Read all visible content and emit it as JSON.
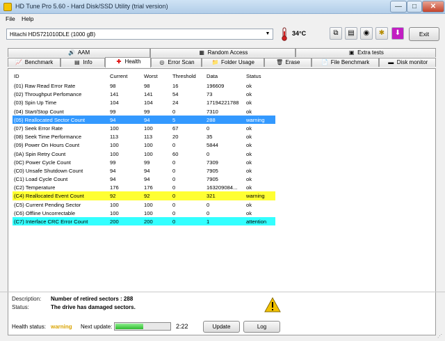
{
  "window": {
    "title": "HD Tune Pro 5.60 - Hard Disk/SSD Utility (trial version)",
    "min_label": "—",
    "max_label": "□",
    "close_label": "✕"
  },
  "menu": [
    "File",
    "Help"
  ],
  "toolbar": {
    "drive": "Hitachi HDS721010DLE (1000 gB)",
    "temperature": "34°C",
    "exit_label": "Exit"
  },
  "tabs_top": [
    {
      "label": "AAM",
      "icon": "speaker-icon"
    },
    {
      "label": "Random Access",
      "icon": "random-access-icon"
    },
    {
      "label": "Extra tests",
      "icon": "extra-tests-icon"
    }
  ],
  "tabs_bottom": [
    {
      "label": "Benchmark",
      "icon": "benchmark-icon"
    },
    {
      "label": "Info",
      "icon": "info-icon"
    },
    {
      "label": "Health",
      "icon": "health-cross-icon",
      "active": true
    },
    {
      "label": "Error Scan",
      "icon": "error-scan-icon"
    },
    {
      "label": "Folder Usage",
      "icon": "folder-usage-icon"
    },
    {
      "label": "Erase",
      "icon": "trash-icon"
    },
    {
      "label": "File Benchmark",
      "icon": "file-benchmark-icon"
    },
    {
      "label": "Disk monitor",
      "icon": "disk-monitor-icon"
    }
  ],
  "table": {
    "headers": [
      "ID",
      "Current",
      "Worst",
      "Threshold",
      "Data",
      "Status"
    ],
    "rows": [
      {
        "id": "(01) Raw Read Error Rate",
        "current": "98",
        "worst": "98",
        "threshold": "16",
        "data": "196609",
        "status": "ok",
        "hl": ""
      },
      {
        "id": "(02) Throughput Perfomance",
        "current": "141",
        "worst": "141",
        "threshold": "54",
        "data": "73",
        "status": "ok",
        "hl": ""
      },
      {
        "id": "(03) Spin Up Time",
        "current": "104",
        "worst": "104",
        "threshold": "24",
        "data": "17194221788",
        "status": "ok",
        "hl": ""
      },
      {
        "id": "(04) Start/Stop Count",
        "current": "99",
        "worst": "99",
        "threshold": "0",
        "data": "7310",
        "status": "ok",
        "hl": ""
      },
      {
        "id": "(05) Reallocated Sector Count",
        "current": "94",
        "worst": "94",
        "threshold": "5",
        "data": "288",
        "status": "warning",
        "hl": "blue"
      },
      {
        "id": "(07) Seek Error Rate",
        "current": "100",
        "worst": "100",
        "threshold": "67",
        "data": "0",
        "status": "ok",
        "hl": ""
      },
      {
        "id": "(08) Seek Time Performance",
        "current": "113",
        "worst": "113",
        "threshold": "20",
        "data": "35",
        "status": "ok",
        "hl": ""
      },
      {
        "id": "(09) Power On Hours Count",
        "current": "100",
        "worst": "100",
        "threshold": "0",
        "data": "5844",
        "status": "ok",
        "hl": ""
      },
      {
        "id": "(0A) Spin Retry Count",
        "current": "100",
        "worst": "100",
        "threshold": "60",
        "data": "0",
        "status": "ok",
        "hl": ""
      },
      {
        "id": "(0C) Power Cycle Count",
        "current": "99",
        "worst": "99",
        "threshold": "0",
        "data": "7309",
        "status": "ok",
        "hl": ""
      },
      {
        "id": "(C0) Unsafe Shutdown Count",
        "current": "94",
        "worst": "94",
        "threshold": "0",
        "data": "7905",
        "status": "ok",
        "hl": ""
      },
      {
        "id": "(C1) Load Cycle Count",
        "current": "94",
        "worst": "94",
        "threshold": "0",
        "data": "7905",
        "status": "ok",
        "hl": ""
      },
      {
        "id": "(C2) Temperature",
        "current": "176",
        "worst": "176",
        "threshold": "0",
        "data": "163209084...",
        "status": "ok",
        "hl": ""
      },
      {
        "id": "(C4) Reallocated Event Count",
        "current": "92",
        "worst": "92",
        "threshold": "0",
        "data": "321",
        "status": "warning",
        "hl": "yellow"
      },
      {
        "id": "(C5) Current Pending Sector",
        "current": "100",
        "worst": "100",
        "threshold": "0",
        "data": "0",
        "status": "ok",
        "hl": ""
      },
      {
        "id": "(C6) Offline Uncorrectable",
        "current": "100",
        "worst": "100",
        "threshold": "0",
        "data": "0",
        "status": "ok",
        "hl": ""
      },
      {
        "id": "(C7) Interface CRC Error Count",
        "current": "200",
        "worst": "200",
        "threshold": "0",
        "data": "1",
        "status": "attention",
        "hl": "cyan"
      }
    ]
  },
  "footer": {
    "description_label": "Description:",
    "description_value": "Number of retired sectors : 288",
    "status_label": "Status:",
    "status_value": "The drive has damaged sectors.",
    "health_label": "Health status:",
    "health_value": "warning",
    "next_update_label": "Next update:",
    "next_update_time": "2:22",
    "next_update_progress": 0.52,
    "update_label": "Update",
    "log_label": "Log"
  },
  "colors": {
    "warning_blue": "#3399ff",
    "warning_yellow": "#ffff33",
    "attention_cyan": "#33ffff",
    "health_warning_text": "#d9a300"
  }
}
